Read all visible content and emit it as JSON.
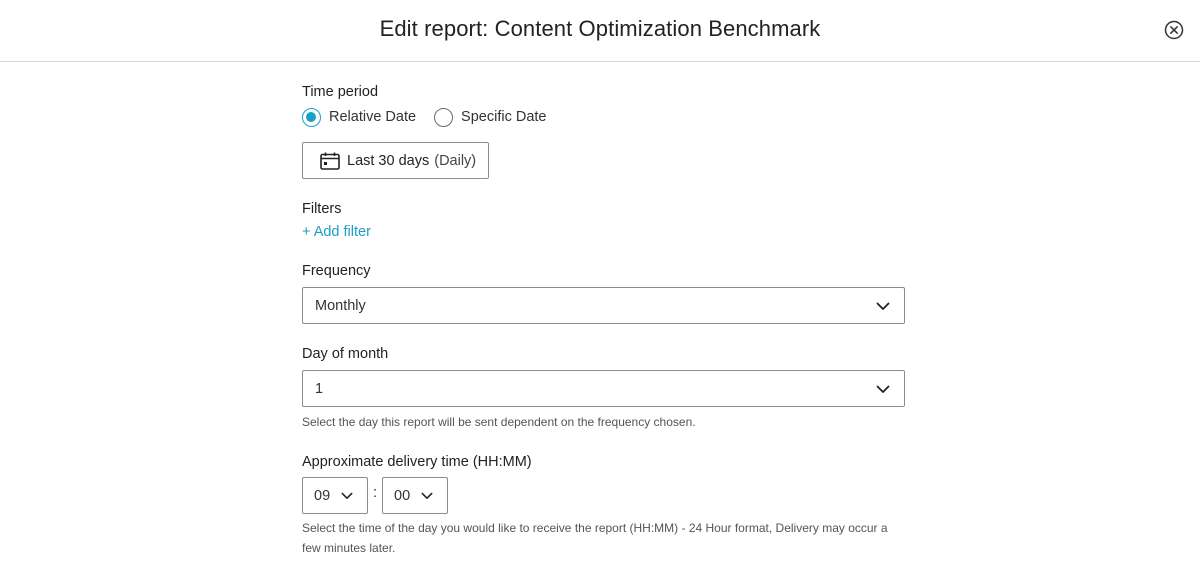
{
  "header": {
    "title": "Edit report: Content Optimization Benchmark",
    "close_icon": "circle-x-icon"
  },
  "time_period": {
    "label": "Time period",
    "options": [
      {
        "label": "Relative Date",
        "checked": true
      },
      {
        "label": "Specific Date",
        "checked": false
      }
    ],
    "date_button": {
      "icon": "calendar-icon",
      "range": "Last 30 days",
      "granularity": "(Daily)"
    }
  },
  "filters": {
    "label": "Filters",
    "add_filter": "+ Add filter"
  },
  "frequency": {
    "label": "Frequency",
    "value": "Monthly"
  },
  "day_of_month": {
    "label": "Day of month",
    "value": "1",
    "help": "Select the day this report will be sent dependent on the frequency chosen."
  },
  "delivery_time": {
    "label": "Approximate delivery time (HH:MM)",
    "hour": "09",
    "separator": ":",
    "minute": "00",
    "help": "Select the time of the day you would like to receive the report (HH:MM) - 24 Hour format, Delivery may occur a few minutes later."
  },
  "colors": {
    "accent": "#1aa0c6",
    "border": "#8c8c8c",
    "divider": "#d9d9d9"
  }
}
